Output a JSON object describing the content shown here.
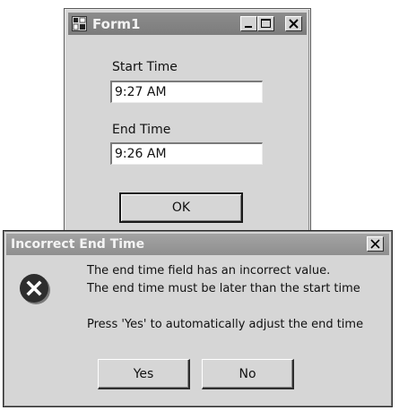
{
  "form": {
    "title": "Form1",
    "start_label": "Start Time",
    "start_value": "9:27 AM",
    "end_label": "End Time",
    "end_value": "9:26 AM",
    "ok_label": "OK"
  },
  "dialog": {
    "title": "Incorrect End Time",
    "line1": "The end time field has an incorrect value.",
    "line2": "The end time must be later than the start time",
    "line3": "Press 'Yes' to automatically adjust the end time",
    "yes_label": "Yes",
    "no_label": "No"
  },
  "icons": {
    "app": "application-icon",
    "minimize": "minimize-icon",
    "maximize": "maximize-icon",
    "close": "close-icon",
    "error": "error-icon"
  }
}
